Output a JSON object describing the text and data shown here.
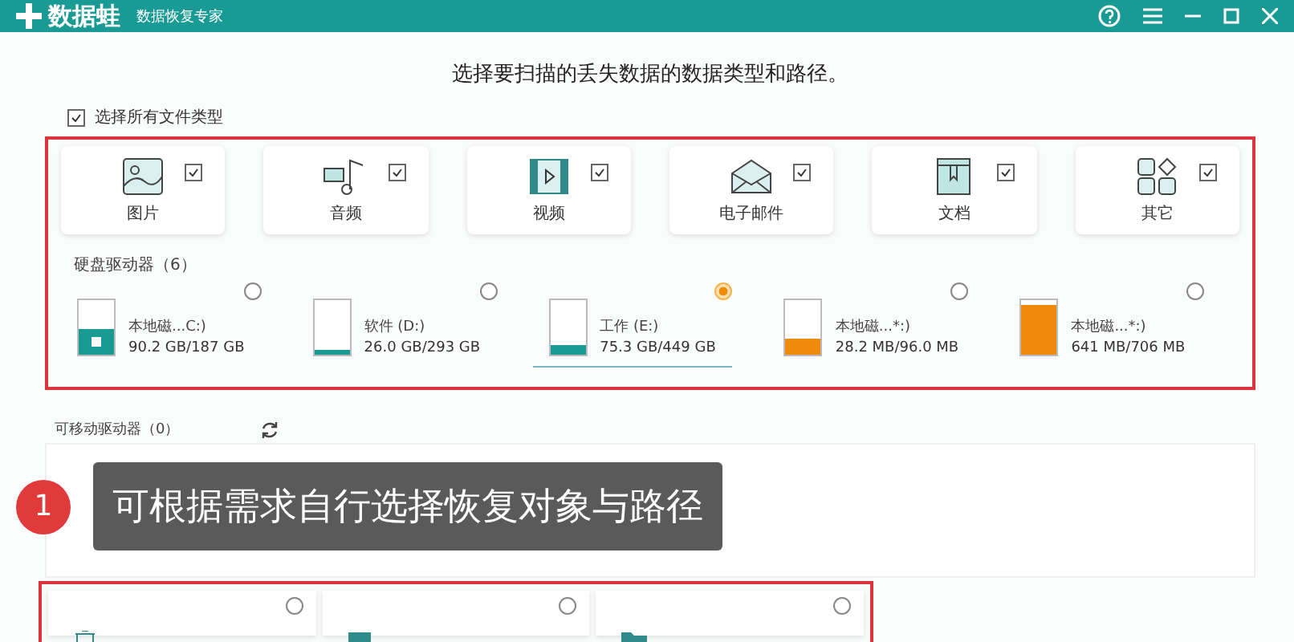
{
  "window": {
    "title": "数据蛙",
    "subtitle": "数据恢复专家"
  },
  "heading": "选择要扫描的丢失数据的数据类型和路径。",
  "select_all": {
    "label": "选择所有文件类型",
    "checked": true
  },
  "categories": [
    {
      "kind": "image",
      "label": "图片",
      "checked": true
    },
    {
      "kind": "audio",
      "label": "音频",
      "checked": true
    },
    {
      "kind": "video",
      "label": "视频",
      "checked": true
    },
    {
      "kind": "email",
      "label": "电子邮件",
      "checked": true
    },
    {
      "kind": "document",
      "label": "文档",
      "checked": true
    },
    {
      "kind": "other",
      "label": "其它",
      "checked": true
    }
  ],
  "disk_drives": {
    "title": "硬盘驱动器（6）",
    "drives": [
      {
        "name": "本地磁...C:)",
        "usage": "90.2 GB/187 GB",
        "level": 0.48,
        "color": "#1a9a94",
        "system": true,
        "selected": false
      },
      {
        "name": "软件 (D:)",
        "usage": "26.0 GB/293 GB",
        "level": 0.09,
        "color": "#1a9a94",
        "system": false,
        "selected": false
      },
      {
        "name": "工作 (E:)",
        "usage": "75.3 GB/449 GB",
        "level": 0.17,
        "color": "#1a9a94",
        "system": false,
        "selected": true
      },
      {
        "name": "本地磁...*:)",
        "usage": "28.2 MB/96.0 MB",
        "level": 0.29,
        "color": "#ef8a0c",
        "system": false,
        "selected": false
      },
      {
        "name": "本地磁...*:)",
        "usage": "641 MB/706 MB",
        "level": 0.91,
        "color": "#ef8a0c",
        "system": false,
        "selected": false
      }
    ]
  },
  "removable_drives": {
    "title": "可移动驱动器（0）"
  },
  "locations": [
    {
      "kind": "trash",
      "selected": false
    },
    {
      "kind": "desktop",
      "selected": false
    },
    {
      "kind": "folder",
      "selected": false
    }
  ],
  "annotation": {
    "number": "1",
    "text": "可根据需求自行选择恢复对象与路径"
  }
}
